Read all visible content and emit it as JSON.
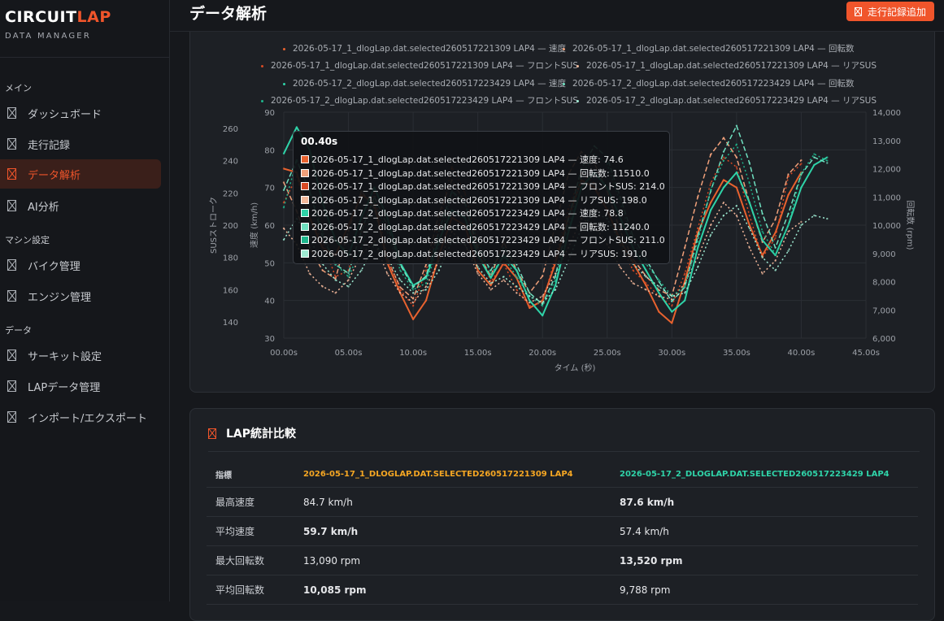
{
  "app": {
    "logo_part1": "CIRCUIT",
    "logo_part2": "LAP",
    "logo_sub": "DATA MANAGER",
    "accent_color": "#f0552b"
  },
  "sidebar": {
    "sections": [
      {
        "label": "メイン",
        "items": [
          {
            "label": "ダッシュボード",
            "icon": "dashboard-icon",
            "active": false
          },
          {
            "label": "走行記録",
            "icon": "run-record-icon",
            "active": false
          },
          {
            "label": "データ解析",
            "icon": "data-analysis-icon",
            "active": true
          },
          {
            "label": "AI分析",
            "icon": "ai-analysis-icon",
            "active": false
          }
        ]
      },
      {
        "label": "マシン設定",
        "items": [
          {
            "label": "バイク管理",
            "icon": "bike-icon",
            "active": false
          },
          {
            "label": "エンジン管理",
            "icon": "engine-icon",
            "active": false
          }
        ]
      },
      {
        "label": "データ",
        "items": [
          {
            "label": "サーキット設定",
            "icon": "circuit-icon",
            "active": false
          },
          {
            "label": "LAPデータ管理",
            "icon": "lap-data-icon",
            "active": false
          },
          {
            "label": "インポート/エクスポート",
            "icon": "import-export-icon",
            "active": false
          }
        ]
      }
    ]
  },
  "header": {
    "title": "データ解析",
    "add_button": "走行記録追加"
  },
  "chart_data": {
    "type": "line",
    "xlabel": "タイム (秒)",
    "x_ticks": [
      "00.00s",
      "05.00s",
      "10.00s",
      "15.00s",
      "20.00s",
      "25.00s",
      "30.00s",
      "35.00s",
      "40.00s",
      "45.00s"
    ],
    "xlim": [
      0,
      45
    ],
    "y_left_outer": {
      "label": "SUSストローク",
      "ticks": [
        "140",
        "160",
        "180",
        "200",
        "220",
        "240",
        "260"
      ]
    },
    "y_left_inner": {
      "label": "速度 (km/h)",
      "ticks": [
        "30",
        "40",
        "50",
        "60",
        "70",
        "80",
        "90"
      ],
      "ylim": [
        30,
        90
      ]
    },
    "y_right": {
      "label": "回転数 (rpm)",
      "ticks": [
        "6,000",
        "7,000",
        "8,000",
        "9,000",
        "10,000",
        "11,000",
        "12,000",
        "13,000",
        "14,000"
      ],
      "ylim": [
        6000,
        14000
      ]
    },
    "series": [
      {
        "name": "2026-05-17_1_dlogLap.dat.selected260517221309 LAP4 — 速度",
        "color": "#e8622f",
        "dash": "solid",
        "axis": "speed",
        "x": [
          0,
          1,
          2,
          3,
          4,
          5,
          6,
          7,
          8,
          9,
          10,
          11,
          12,
          13,
          14,
          15,
          16,
          17,
          18,
          19,
          20,
          21,
          22,
          23,
          24,
          25,
          26,
          27,
          28,
          29,
          30,
          31,
          32,
          33,
          34,
          35,
          36,
          37,
          38,
          39,
          40
        ],
        "y": [
          75,
          74,
          62,
          54,
          52,
          60,
          68,
          66,
          50,
          42,
          35,
          40,
          52,
          62,
          60,
          48,
          44,
          50,
          46,
          38,
          40,
          50,
          62,
          72,
          70,
          64,
          56,
          50,
          44,
          37,
          34,
          45,
          58,
          66,
          72,
          70,
          60,
          52,
          58,
          68,
          74
        ]
      },
      {
        "name": "2026-05-17_1_dlogLap.dat.selected260517221309 LAP4 — 回転数",
        "color": "#f0a07a",
        "dash": "dashed",
        "axis": "rpm",
        "x": [
          0,
          1,
          2,
          3,
          4,
          5,
          6,
          7,
          8,
          9,
          10,
          11,
          12,
          13,
          14,
          15,
          16,
          17,
          18,
          19,
          20,
          21,
          22,
          23,
          24,
          25,
          26,
          27,
          28,
          29,
          30,
          31,
          32,
          33,
          34,
          35,
          36,
          37,
          38,
          39,
          40
        ],
        "y": [
          11510,
          10500,
          9200,
          8400,
          8100,
          9800,
          11200,
          10600,
          8800,
          7800,
          7400,
          8600,
          10400,
          11600,
          10800,
          9000,
          8200,
          9400,
          8400,
          7600,
          8200,
          10000,
          11800,
          12600,
          12200,
          11200,
          9800,
          8800,
          8200,
          7700,
          7500,
          9200,
          11000,
          12500,
          13090,
          12400,
          10800,
          9400,
          10200,
          11800,
          12300
        ]
      },
      {
        "name": "2026-05-17_1_dlogLap.dat.selected260517221309 LAP4 — フロントSUS",
        "color": "#d84a24",
        "dash": "dotted",
        "axis": "sus",
        "x": [
          0,
          1,
          2,
          3,
          4,
          5,
          6,
          7,
          8,
          9,
          10,
          11,
          12,
          13,
          14,
          15,
          16,
          17,
          18,
          19,
          20,
          21,
          22,
          23,
          24,
          25,
          26,
          27,
          28,
          29,
          30,
          31,
          32,
          33,
          34,
          35,
          36,
          37,
          38,
          39,
          40
        ],
        "y": [
          214,
          230,
          205,
          190,
          168,
          172,
          196,
          220,
          180,
          160,
          150,
          172,
          200,
          236,
          220,
          188,
          165,
          176,
          160,
          150,
          152,
          180,
          210,
          232,
          226,
          210,
          188,
          172,
          164,
          156,
          150,
          170,
          198,
          226,
          242,
          236,
          206,
          180,
          192,
          230,
          238
        ]
      },
      {
        "name": "2026-05-17_1_dlogLap.dat.selected260517221309 LAP4 — リアSUS",
        "color": "#f2b79a",
        "dash": "dotted",
        "axis": "sus",
        "x": [
          0,
          1,
          2,
          3,
          4,
          5,
          6,
          7,
          8,
          9,
          10,
          11,
          12,
          13,
          14,
          15,
          16,
          17,
          18,
          19,
          20,
          21,
          22,
          23,
          24,
          25,
          26,
          27,
          28,
          29,
          30,
          31,
          32,
          33,
          34,
          35,
          36,
          37,
          38,
          39,
          40
        ],
        "y": [
          198,
          188,
          170,
          162,
          158,
          166,
          182,
          190,
          170,
          158,
          152,
          162,
          178,
          196,
          188,
          170,
          160,
          166,
          158,
          152,
          156,
          170,
          186,
          204,
          200,
          188,
          174,
          164,
          160,
          156,
          154,
          164,
          180,
          200,
          214,
          206,
          186,
          170,
          178,
          196,
          202
        ]
      },
      {
        "name": "2026-05-17_2_dlogLap.dat.selected260517223429 LAP4 — 速度",
        "color": "#2fd3a8",
        "dash": "solid",
        "axis": "speed",
        "x": [
          0,
          1,
          2,
          3,
          4,
          5,
          6,
          7,
          8,
          9,
          10,
          11,
          12,
          13,
          14,
          15,
          16,
          17,
          18,
          19,
          20,
          21,
          22,
          23,
          24,
          25,
          26,
          27,
          28,
          29,
          30,
          31,
          32,
          33,
          34,
          35,
          36,
          37,
          38,
          39,
          40,
          41,
          42
        ],
        "y": [
          79,
          86,
          80,
          66,
          56,
          52,
          62,
          70,
          62,
          50,
          44,
          46,
          56,
          64,
          62,
          52,
          46,
          52,
          48,
          40,
          36,
          44,
          58,
          70,
          74,
          70,
          62,
          54,
          48,
          42,
          37,
          40,
          54,
          64,
          70,
          74,
          66,
          56,
          52,
          60,
          70,
          76,
          78
        ]
      },
      {
        "name": "2026-05-17_2_dlogLap.dat.selected260517223429 LAP4 — 回転数",
        "color": "#6fe0c0",
        "dash": "dashed",
        "axis": "rpm",
        "x": [
          0,
          1,
          2,
          3,
          4,
          5,
          6,
          7,
          8,
          9,
          10,
          11,
          12,
          13,
          14,
          15,
          16,
          17,
          18,
          19,
          20,
          21,
          22,
          23,
          24,
          25,
          26,
          27,
          28,
          29,
          30,
          31,
          32,
          33,
          34,
          35,
          36,
          37,
          38,
          39,
          40,
          41,
          42
        ],
        "y": [
          11240,
          12300,
          11200,
          9600,
          8600,
          8300,
          9800,
          11000,
          10000,
          8600,
          7800,
          8200,
          9800,
          11200,
          10800,
          9200,
          8400,
          9200,
          8600,
          7600,
          7200,
          8200,
          10200,
          12000,
          12800,
          12400,
          11000,
          9600,
          8800,
          8000,
          7300,
          7800,
          9600,
          11200,
          12600,
          13520,
          12200,
          10400,
          9200,
          10400,
          11800,
          12400,
          12200
        ]
      },
      {
        "name": "2026-05-17_2_dlogLap.dat.selected260517223429 LAP4 — フロントSUS",
        "color": "#1fb58c",
        "dash": "dotted",
        "axis": "sus",
        "x": [
          0,
          1,
          2,
          3,
          4,
          5,
          6,
          7,
          8,
          9,
          10,
          11,
          12,
          13,
          14,
          15,
          16,
          17,
          18,
          19,
          20,
          21,
          22,
          23,
          24,
          25,
          26,
          27,
          28,
          29,
          30,
          31,
          32,
          33,
          34,
          35,
          36,
          37,
          38,
          39,
          40,
          41,
          42
        ],
        "y": [
          211,
          240,
          222,
          196,
          176,
          168,
          186,
          214,
          196,
          172,
          160,
          164,
          188,
          220,
          214,
          190,
          170,
          180,
          168,
          156,
          150,
          166,
          198,
          230,
          244,
          238,
          214,
          190,
          176,
          166,
          156,
          162,
          190,
          222,
          240,
          250,
          226,
          196,
          182,
          200,
          232,
          244,
          240
        ]
      },
      {
        "name": "2026-05-17_2_dlogLap.dat.selected260517223429 LAP4 — リアSUS",
        "color": "#9eead2",
        "dash": "dotted",
        "axis": "sus",
        "x": [
          0,
          1,
          2,
          3,
          4,
          5,
          6,
          7,
          8,
          9,
          10,
          11,
          12,
          13,
          14,
          15,
          16,
          17,
          18,
          19,
          20,
          21,
          22,
          23,
          24,
          25,
          26,
          27,
          28,
          29,
          30,
          31,
          32,
          33,
          34,
          35,
          36,
          37,
          38,
          39,
          40,
          41,
          42
        ],
        "y": [
          191,
          204,
          192,
          176,
          166,
          162,
          172,
          188,
          180,
          166,
          158,
          160,
          172,
          190,
          188,
          174,
          164,
          168,
          162,
          156,
          152,
          160,
          178,
          198,
          208,
          204,
          190,
          176,
          168,
          162,
          156,
          158,
          174,
          194,
          206,
          212,
          198,
          180,
          172,
          184,
          200,
          206,
          204
        ]
      }
    ],
    "tooltip": {
      "title": "00.40s",
      "rows": [
        "2026-05-17_1_dlogLap.dat.selected260517221309 LAP4 — 速度: 74.6",
        "2026-05-17_1_dlogLap.dat.selected260517221309 LAP4 — 回転数: 11510.0",
        "2026-05-17_1_dlogLap.dat.selected260517221309 LAP4 — フロントSUS: 214.0",
        "2026-05-17_1_dlogLap.dat.selected260517221309 LAP4 — リアSUS: 198.0",
        "2026-05-17_2_dlogLap.dat.selected260517223429 LAP4 — 速度: 78.8",
        "2026-05-17_2_dlogLap.dat.selected260517223429 LAP4 — 回転数: 11240.0",
        "2026-05-17_2_dlogLap.dat.selected260517223429 LAP4 — フロントSUS: 211.0",
        "2026-05-17_2_dlogLap.dat.selected260517223429 LAP4 — リアSUS: 191.0"
      ]
    }
  },
  "stats": {
    "title": "LAP統計比較",
    "headers": [
      "指標",
      "2026-05-17_1_DLOGLAP.DAT.SELECTED260517221309 LAP4",
      "2026-05-17_2_DLOGLAP.DAT.SELECTED260517223429 LAP4"
    ],
    "rows": [
      {
        "metric": "最高速度",
        "a": "84.7 km/h",
        "b": "87.6 km/h",
        "best": "b"
      },
      {
        "metric": "平均速度",
        "a": "59.7 km/h",
        "b": "57.4 km/h",
        "best": "a"
      },
      {
        "metric": "最大回転数",
        "a": "13,090 rpm",
        "b": "13,520 rpm",
        "best": "b"
      },
      {
        "metric": "平均回転数",
        "a": "10,085 rpm",
        "b": "9,788 rpm",
        "best": "a"
      }
    ]
  }
}
